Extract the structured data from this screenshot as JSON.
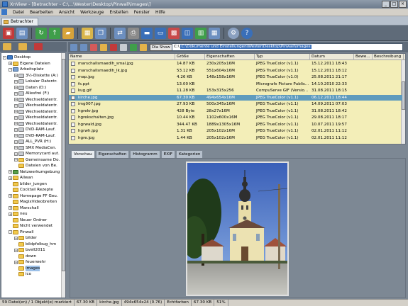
{
  "window": {
    "title": "XnView - [Betrachter - C:\\...\\Wester\\Desktop\\Pinwall\\images\\]"
  },
  "menu": [
    "Datei",
    "Bearbeiten",
    "Ansicht",
    "Werkzeuge",
    "Erstellen",
    "Fenster",
    "Hilfe"
  ],
  "tab": {
    "label": "Betrachter"
  },
  "nav": {
    "diashow_label": "Dia Show",
    "path_prefix": "C:\\",
    "path_selected": "C:\\Dokumente und Einstellungen\\Wester\\Desktop\\Pinwall\\images"
  },
  "tree": {
    "items": [
      {
        "label": "Desktop",
        "icon": "desktop",
        "indent": 0,
        "toggle": "-"
      },
      {
        "label": "Eigene Dateien",
        "icon": "folder",
        "indent": 1,
        "toggle": "+"
      },
      {
        "label": "Arbeitsplatz",
        "icon": "pc",
        "indent": 1,
        "toggle": "-"
      },
      {
        "label": "3½-Diskette (A:)",
        "icon": "drive",
        "indent": 2,
        "toggle": "+"
      },
      {
        "label": "Lokaler Datentr.",
        "icon": "drive",
        "indent": 2,
        "toggle": "+"
      },
      {
        "label": "Daten (D:)",
        "icon": "drive",
        "indent": 2,
        "toggle": "+"
      },
      {
        "label": "Allesfrei (F:)",
        "icon": "drive",
        "indent": 2,
        "toggle": "+"
      },
      {
        "label": "Wechseldatentr.",
        "icon": "drive",
        "indent": 2,
        "toggle": "+"
      },
      {
        "label": "Wechseldatentr.",
        "icon": "drive",
        "indent": 2,
        "toggle": "+"
      },
      {
        "label": "Wechseldatentr.",
        "icon": "drive",
        "indent": 2,
        "toggle": "+"
      },
      {
        "label": "Wechseldatentr.",
        "icon": "drive",
        "indent": 2,
        "toggle": "+"
      },
      {
        "label": "Wechseldatentr.",
        "icon": "drive",
        "indent": 2,
        "toggle": "+"
      },
      {
        "label": "DVD-RAM-Lauf.",
        "icon": "drive",
        "indent": 2,
        "toggle": "+"
      },
      {
        "label": "DVD-RAM-Lauf.",
        "icon": "drive",
        "indent": 2,
        "toggle": "+"
      },
      {
        "label": "ALL_PVR (H:)",
        "icon": "drive",
        "indent": 2,
        "toggle": "+"
      },
      {
        "label": "SMX MediaCen.",
        "icon": "drive",
        "indent": 2,
        "toggle": "+"
      },
      {
        "label": "Memorycard aut.",
        "icon": "drive",
        "indent": 2,
        "toggle": "+"
      },
      {
        "label": "Gemeinsame Do.",
        "icon": "folder",
        "indent": 2,
        "toggle": "+"
      },
      {
        "label": "Dateien von Be.",
        "icon": "folder",
        "indent": 2,
        "toggle": ""
      },
      {
        "label": "Netzwerkumgebung",
        "icon": "net",
        "indent": 1,
        "toggle": "+"
      },
      {
        "label": "Allwan",
        "icon": "folder",
        "indent": 1,
        "toggle": "+"
      },
      {
        "label": "bilder_jungen",
        "icon": "folder",
        "indent": 1,
        "toggle": ""
      },
      {
        "label": "Cocktail Rezepte",
        "icon": "folder",
        "indent": 1,
        "toggle": ""
      },
      {
        "label": "Homepage FF Geu.",
        "icon": "folder",
        "indent": 1,
        "toggle": "+"
      },
      {
        "label": "MagixVideobreiten",
        "icon": "folder",
        "indent": 1,
        "toggle": ""
      },
      {
        "label": "Marschall",
        "icon": "folder",
        "indent": 1,
        "toggle": "+"
      },
      {
        "label": "neu",
        "icon": "folder",
        "indent": 1,
        "toggle": "+"
      },
      {
        "label": "Neuer Ordner",
        "icon": "folder",
        "indent": 1,
        "toggle": ""
      },
      {
        "label": "Nicht verwendet",
        "icon": "folder",
        "indent": 1,
        "toggle": ""
      },
      {
        "label": "Pinwall",
        "icon": "folder",
        "indent": 1,
        "toggle": "-"
      },
      {
        "label": "bilder",
        "icon": "folder",
        "indent": 2,
        "toggle": "+"
      },
      {
        "label": "bildpfolbug_hm",
        "icon": "folder",
        "indent": 2,
        "toggle": ""
      },
      {
        "label": "bvell2011",
        "icon": "folder",
        "indent": 2,
        "toggle": "+"
      },
      {
        "label": "down",
        "icon": "folder",
        "indent": 2,
        "toggle": ""
      },
      {
        "label": "feuerwehr",
        "icon": "folder",
        "indent": 2,
        "toggle": "+"
      },
      {
        "label": "images",
        "icon": "folder",
        "indent": 2,
        "toggle": "",
        "selected": true
      },
      {
        "label": "ico",
        "icon": "folder",
        "indent": 2,
        "toggle": ""
      }
    ]
  },
  "filelist": {
    "columns": [
      "Name",
      "Größe",
      "Eigenschaften",
      "Typ",
      "Datum",
      "Bewe...",
      "Beschreibung"
    ],
    "rows": [
      {
        "name": "marschallsmaedlh_smal.jpg",
        "size": "14.87 KB",
        "props": "230x205x16M",
        "type": "JPEG TrueColor (v1.1)",
        "date": "15.12.2011 18:43"
      },
      {
        "name": "marschallsmaedlh_lk.jpg",
        "size": "53.12 KB",
        "props": "551x604x16M",
        "type": "JPEG TrueColor (v1.1)",
        "date": "15.12.2011 18:12"
      },
      {
        "name": "map.jpg",
        "size": "4.26 KB",
        "props": "148x158x16M",
        "type": "JPEG TrueColor (v1.0)",
        "date": "25.08.2011 21:17"
      },
      {
        "name": "fs.ppt",
        "size": "13.00 KB",
        "props": "",
        "type": "Micrografx Picture Publis...",
        "date": "14.10.2010 22:33"
      },
      {
        "name": "kug.gif",
        "size": "11.28 KB",
        "props": "153x315x256",
        "type": "CompuServe GIF (Versio...",
        "date": "31.08.2011 18:15"
      },
      {
        "name": "kirche.jpg",
        "size": "67.30 KB",
        "props": "494x654x16M",
        "type": "JPEG TrueColor (v1.1)",
        "date": "06.12.2011 18:44",
        "selected": true
      },
      {
        "name": "img007.jpg",
        "size": "27.93 KB",
        "props": "500x345x16M",
        "type": "JPEG TrueColor (v1.1)",
        "date": "14.09.2011 07:03"
      },
      {
        "name": "hgrekr.jpg",
        "size": "428 Byte",
        "props": "28x27x16M",
        "type": "JPEG TrueColor (v1.1)",
        "date": "31.08.2011 18:42"
      },
      {
        "name": "hgrekschalten.jpg",
        "size": "10.44 KB",
        "props": "1102x600x16M",
        "type": "JPEG TrueColor (v1.1)",
        "date": "29.08.2011 18:17"
      },
      {
        "name": "hgrwald.jpg",
        "size": "344.47 KB",
        "props": "1889x1305x16M",
        "type": "JPEG TrueColor (v1.1)",
        "date": "10.07.2011 19:57"
      },
      {
        "name": "hgrwh.jpg",
        "size": "1.31 KB",
        "props": "205x102x16M",
        "type": "JPEG TrueColor (v1.1)",
        "date": "02.01.2011 11:12"
      },
      {
        "name": "hgre.jpg",
        "size": "1.44 KB",
        "props": "205x102x16M",
        "type": "JPEG TrueColor (v1.1)",
        "date": "02.01.2011 11:12"
      }
    ]
  },
  "preview_tabs": [
    "Vorschau",
    "Eigenschaften",
    "Histogramm",
    "EXIF",
    "Kategorien"
  ],
  "status": [
    "59 Datei(en) / 1 Objekt(e) markiert",
    "67.30 KB",
    "kirche.jpg",
    "494x654x24 (0.76)",
    "Echtfarben",
    "67.30 KB",
    "51%"
  ],
  "colors": {
    "accent": "#3a6fb8",
    "list_bg": "#f3eeb8",
    "selection": "#5f9bbd",
    "chrome": "#5f6b79"
  }
}
